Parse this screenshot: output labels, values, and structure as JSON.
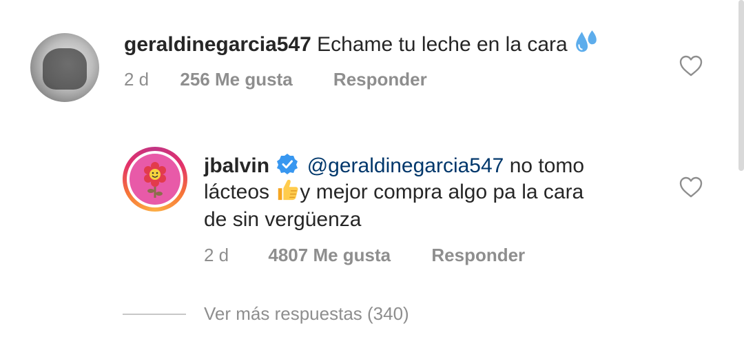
{
  "comments": [
    {
      "username": "geraldinegarcia547",
      "text": "Echame tu leche en la cara",
      "emoji_icon": "sweat-droplets-icon",
      "time": "2 d",
      "likes": "256 Me gusta",
      "reply_label": "Responder"
    }
  ],
  "reply": {
    "username": "jbalvin",
    "verified_icon": "verified-badge-icon",
    "mention": "@geraldinegarcia547",
    "text_part1": " no tomo",
    "text_line2_prefix": "lácteos ",
    "emoji_icon": "thumbs-up-icon",
    "text_line2_suffix": "y mejor compra algo pa la cara",
    "text_line3": "de sin vergüenza",
    "time": "2 d",
    "likes": "4807 Me gusta",
    "reply_label": "Responder"
  },
  "view_more": "Ver más respuestas (340)",
  "colors": {
    "text": "#262626",
    "secondary": "#8e8e8e",
    "mention": "#00376b",
    "verified": "#3897f0"
  }
}
